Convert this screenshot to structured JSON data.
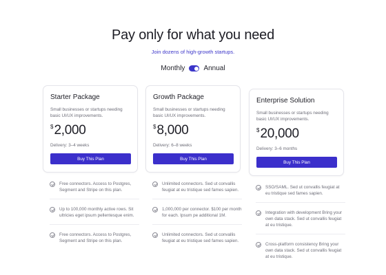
{
  "header": {
    "title": "Pay only for what you need",
    "subtitle": "Join dozens of high-growth startups."
  },
  "billing_toggle": {
    "left_label": "Monthly",
    "right_label": "Annual",
    "selected": "Annual"
  },
  "plans": [
    {
      "name": "Starter Package",
      "description": "Small businesses or startups needing basic UI/UX improvements.",
      "currency": "$",
      "price": "2,000",
      "delivery": "Delivery: 3–4 weeks",
      "button": "Buy This Plan",
      "features": [
        "Free connectors. Access to Postgres, Segment and Stripe on this plan.",
        "Up to 100,000 monthly active rows. Sit ultricies eget ipsum pellentesque enim.",
        "Free connectors. Access to Postgres, Segment and Stripe on this plan."
      ]
    },
    {
      "name": "Growth Package",
      "description": "Small businesses or startups needing basic UI/UX improvements.",
      "currency": "$",
      "price": "8,000",
      "delivery": "Delivery: 6–8 weeks",
      "button": "Buy This Plan",
      "features": [
        "Unlimited connectors. Sed ut convallis feugiat at eu tristique sed fames sapien.",
        "1,000,000 per connector. $100 per month for each. Ipsum pe additional 1M.",
        "Unlimited connectors. Sed ut convallis feugiat at eu tristique sed fames sapien."
      ]
    },
    {
      "name": "Enterprise Solution",
      "description": "Small businesses or startups needing basic UI/UX improvements.",
      "currency": "$",
      "price": "20,000",
      "delivery": "Delivery: 3–6 months",
      "button": "Buy This Plan",
      "features": [
        "SSO/SAML. Sed ut convallis feugiat at eu tristique sed fames sapien.",
        "Integration with development Bring your own data stack. Sed ut convallis feugiat at eu tristique.",
        "Cross-platform consistency Bring your own data stack. Sed ut convallis feugiat at eu tristique."
      ]
    }
  ],
  "colors": {
    "accent": "#3b2fcb",
    "text": "#1d1d25",
    "muted": "#6d6d78",
    "border": "#e4e4ea"
  }
}
